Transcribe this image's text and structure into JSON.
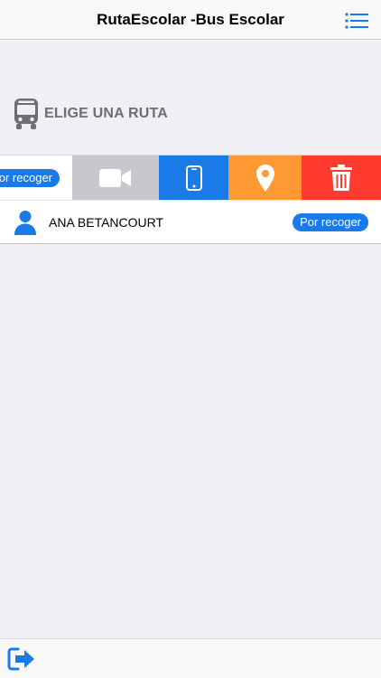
{
  "navbar": {
    "title": "RutaEscolar -Bus Escolar",
    "menu_icon": "list-menu-icon"
  },
  "section": {
    "icon": "bus-icon",
    "title": "ELIGE UNA RUTA"
  },
  "swiped_row": {
    "status": "Por recoger",
    "actions": [
      {
        "name": "video",
        "icon": "video-camera-icon",
        "color": "#c7c7cc"
      },
      {
        "name": "phone",
        "icon": "mobile-phone-icon",
        "color": "#1a7ae8"
      },
      {
        "name": "location",
        "icon": "map-pin-icon",
        "color": "#ff9933"
      },
      {
        "name": "delete",
        "icon": "trash-icon",
        "color": "#ff3b30"
      }
    ]
  },
  "students": [
    {
      "name": "ANA BETANCOURT",
      "status": "Por recoger",
      "icon": "person-icon"
    }
  ],
  "footer": {
    "logout_icon": "logout-icon"
  },
  "colors": {
    "accent": "#1a7ae8",
    "background": "#efeff4",
    "section_text": "#6d6d72"
  }
}
